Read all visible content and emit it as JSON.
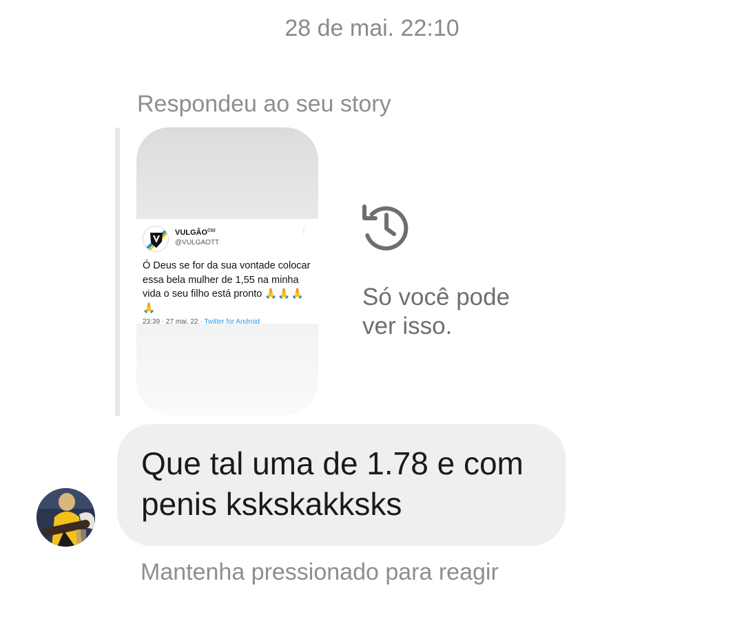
{
  "thread": {
    "timestamp": "28 de mai. 22:10",
    "reply_label": "Respondeu ao seu story"
  },
  "story": {
    "tweet": {
      "display_name": "VULGÃO",
      "display_name_sup": "CS2",
      "handle": "@VULGAOTT",
      "more_icon": "more-vertical-icon",
      "text": "Ó Deus se for da sua vontade colocar essa bela mulher de 1,55 na minha vida o seu filho está pronto",
      "emoji": "🙏🙏🙏🙏",
      "meta_time": "23:39 · 27 mai. 22 · ",
      "meta_source": "Twitter for Android"
    },
    "expired_icon": "history-icon",
    "expired_text_line1": "Só você pode",
    "expired_text_line2": "ver isso."
  },
  "message": {
    "line1": "Que tal uma de 1.78 e com",
    "line2": "penis kskskakksks",
    "sender_avatar": "avatar"
  },
  "hint": "Mantenha pressionado para reagir",
  "colors": {
    "bubble": "#efefef",
    "muted_text": "#8e8e8e",
    "reply_bar": "#e6e6e6"
  }
}
